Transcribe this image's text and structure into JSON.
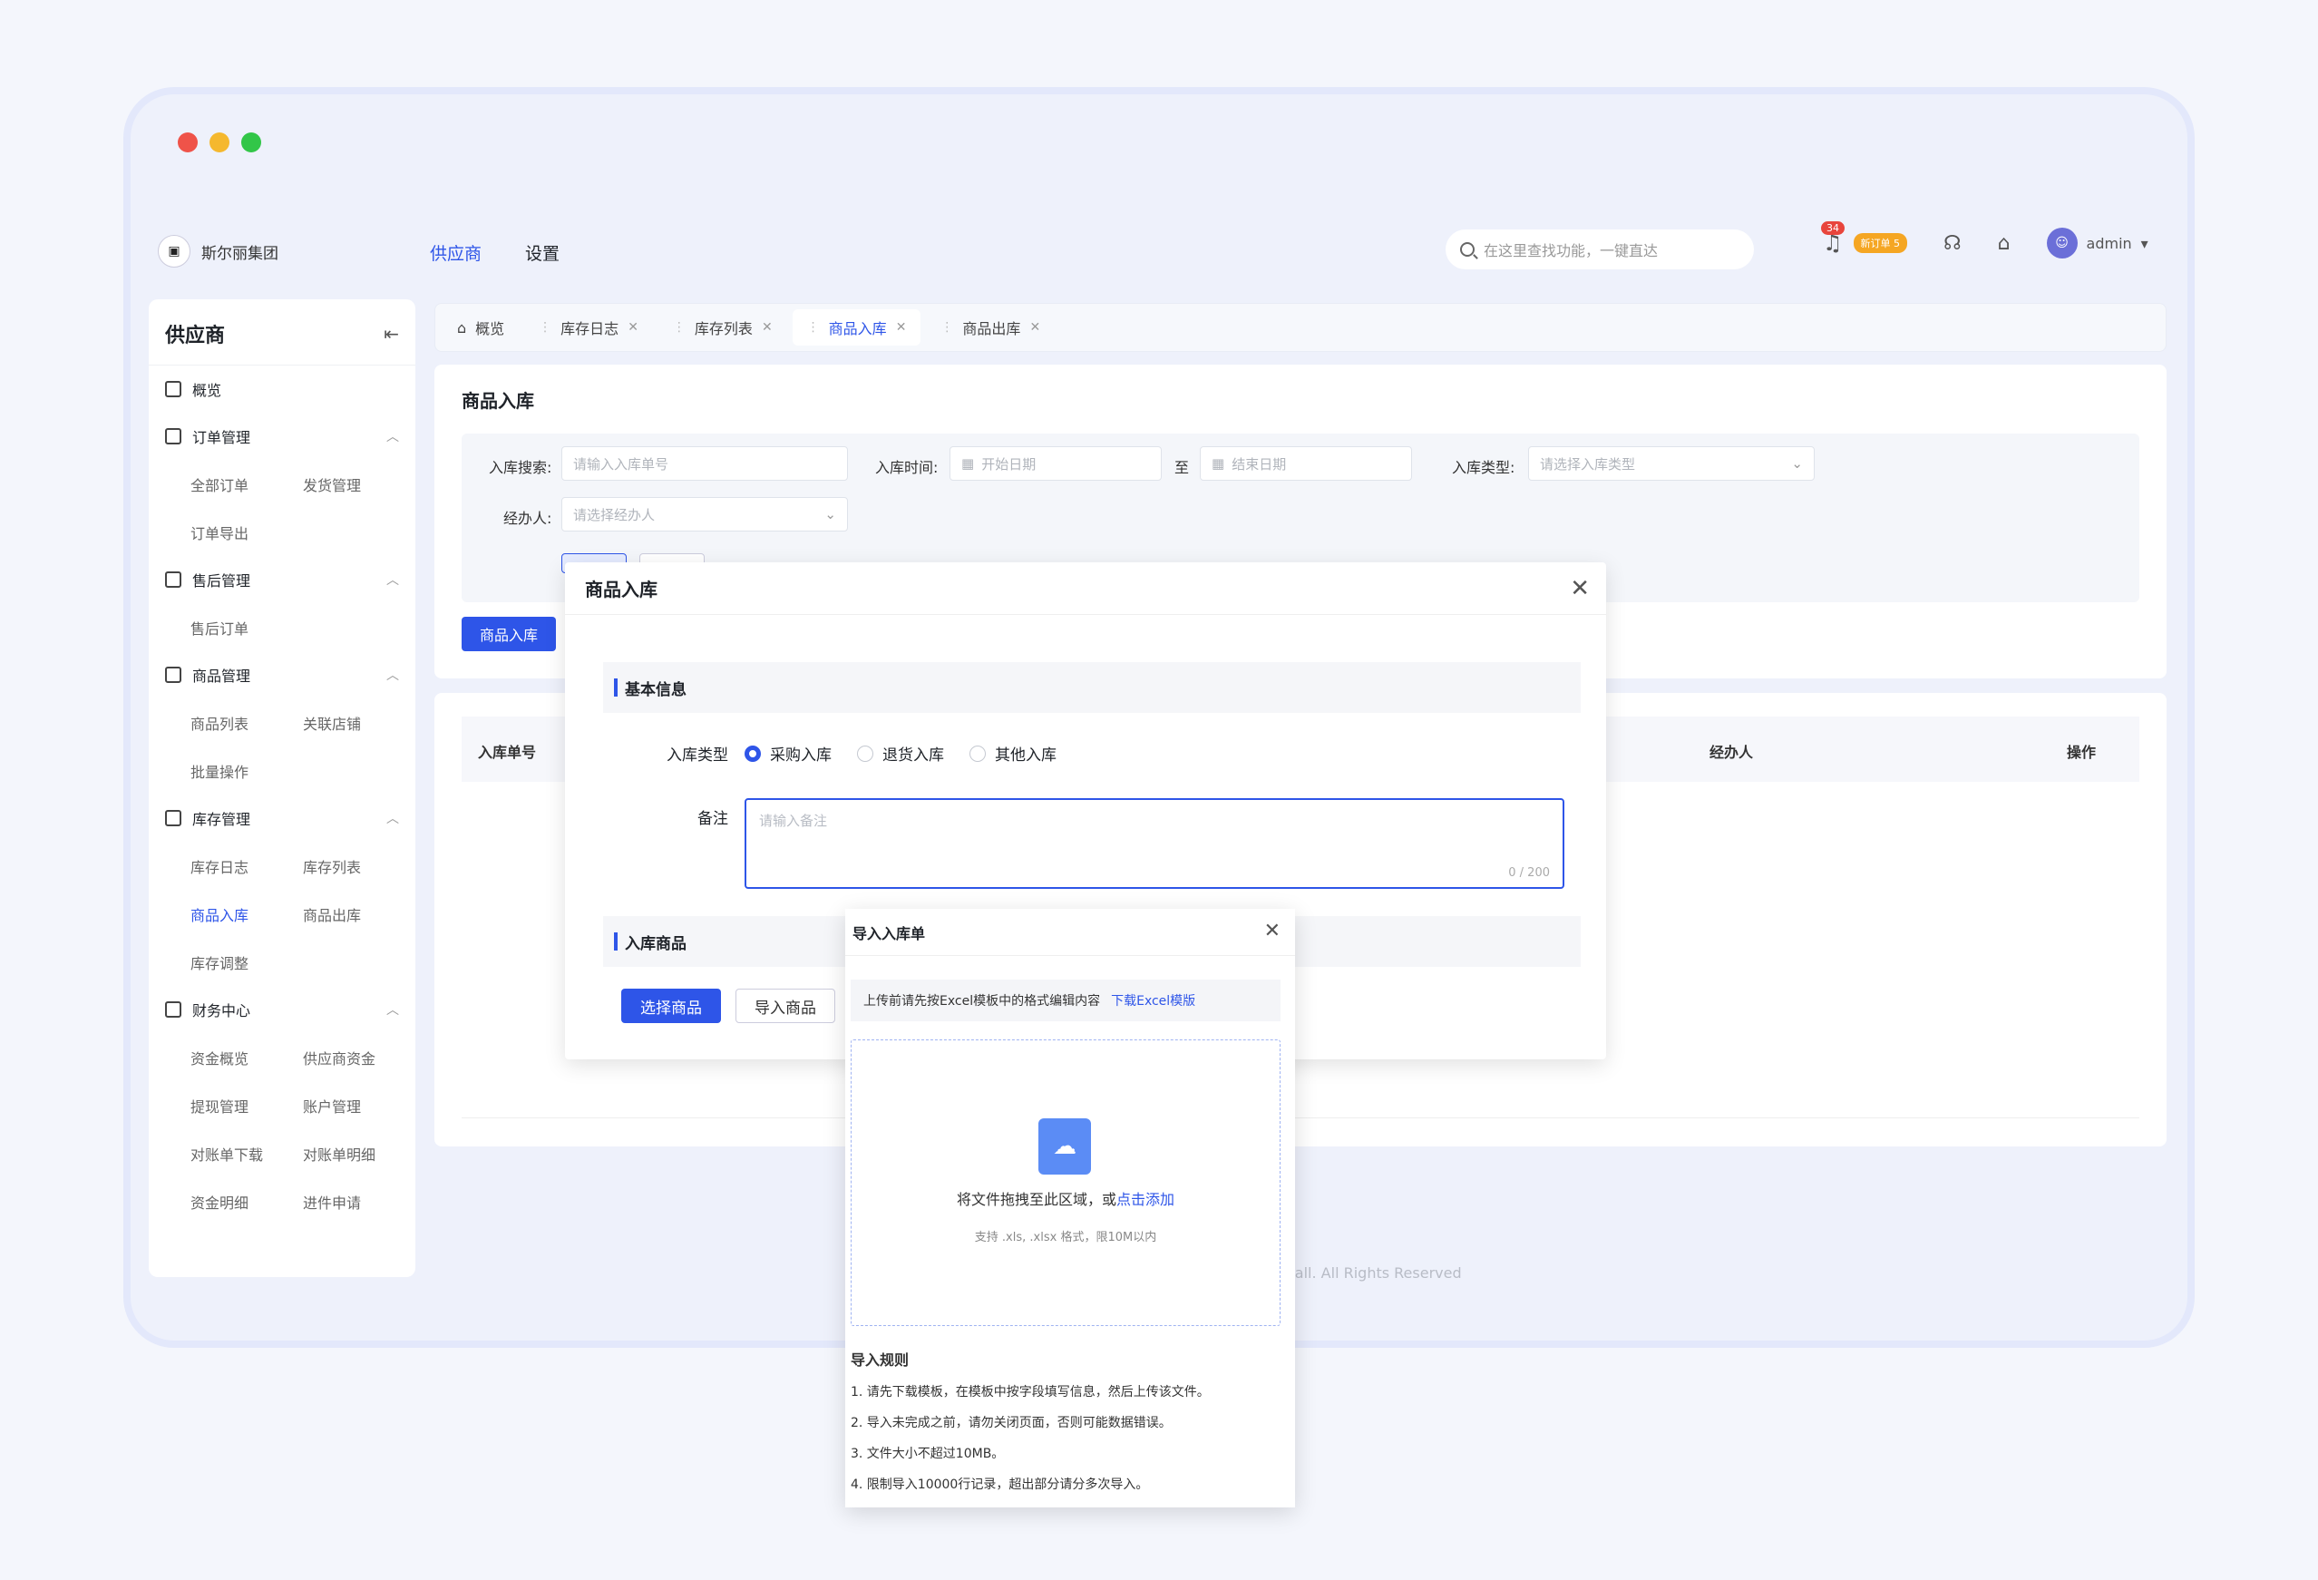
{
  "colors": {
    "accent": "#2e55e8",
    "red_dot": "#ef5349",
    "yellow_dot": "#f5b82e",
    "green_dot": "#32c648"
  },
  "header": {
    "brand": "斯尔丽集团",
    "nav": [
      "供应商",
      "设置"
    ],
    "search_placeholder": "在这里查找功能，一键直达",
    "bell_count": "34",
    "new_order_badge": "新订单 5",
    "user": "admin"
  },
  "sidebar": {
    "title": "供应商",
    "overview": "概览",
    "groups": [
      {
        "label": "订单管理",
        "items": [
          "全部订单",
          "发货管理",
          "订单导出"
        ]
      },
      {
        "label": "售后管理",
        "items": [
          "售后订单"
        ]
      },
      {
        "label": "商品管理",
        "items": [
          "商品列表",
          "关联店铺",
          "批量操作"
        ]
      },
      {
        "label": "库存管理",
        "items": [
          "库存日志",
          "库存列表",
          "商品入库",
          "商品出库",
          "库存调整"
        ]
      },
      {
        "label": "财务中心",
        "items": [
          "资金概览",
          "供应商资金",
          "提现管理",
          "账户管理",
          "对账单下载",
          "对账单明细",
          "资金明细",
          "进件申请"
        ]
      }
    ]
  },
  "tabs": [
    "概览",
    "库存日志",
    "库存列表",
    "商品入库",
    "商品出库"
  ],
  "page": {
    "title": "商品入库",
    "filters": {
      "search_label": "入库搜索:",
      "search_placeholder": "请输入入库单号",
      "time_label": "入库时间:",
      "start_placeholder": "开始日期",
      "to": "至",
      "end_placeholder": "结束日期",
      "type_label": "入库类型:",
      "type_placeholder": "请选择入库类型",
      "operator_label": "经办人:",
      "operator_placeholder": "请选择经办人"
    },
    "add_button": "商品入库",
    "table_headers": [
      "入库单号",
      "经办人",
      "操作"
    ],
    "copyright": "Mall. All Rights Reserved"
  },
  "modal": {
    "title": "商品入库",
    "basic_section": "基本信息",
    "type_label": "入库类型",
    "types": [
      "采购入库",
      "退货入库",
      "其他入库"
    ],
    "remark_label": "备注",
    "remark_placeholder": "请输入备注",
    "remark_count": "0 / 200",
    "goods_section": "入库商品",
    "select_goods": "选择商品",
    "import_goods": "导入商品"
  },
  "import_modal": {
    "title": "导入入库单",
    "tip": "上传前请先按Excel模板中的格式编辑内容",
    "download": "下载Excel模版",
    "drop_text": "将文件拖拽至此区域，或",
    "drop_link": "点击添加",
    "drop_sub": "支持 .xls, .xlsx 格式，限10M以内",
    "rules_title": "导入规则",
    "rules": [
      "1. 请先下载模板，在模板中按字段填写信息，然后上传该文件。",
      "2. 导入未完成之前，请勿关闭页面，否则可能数据错误。",
      "3. 文件大小不超过10MB。",
      "4. 限制导入10000行记录，超出部分请分多次导入。"
    ]
  }
}
